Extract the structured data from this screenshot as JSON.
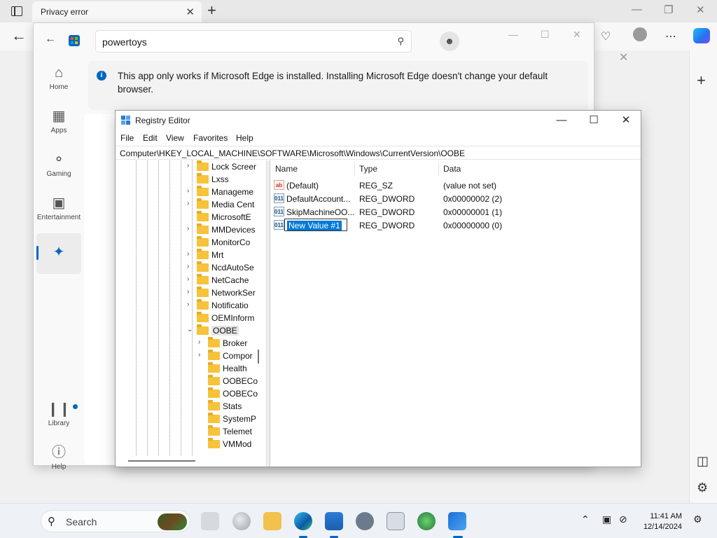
{
  "browser": {
    "tab_title": "Privacy error",
    "tab_close": "✕",
    "new_tab": "+"
  },
  "store": {
    "search_value": "powertoys",
    "banner_text": "This app only works if Microsoft Edge is installed. Installing Microsoft Edge doesn't change your default browser.",
    "nav": [
      {
        "label": "Home",
        "icon": "home-icon"
      },
      {
        "label": "Apps",
        "icon": "apps-icon"
      },
      {
        "label": "Gaming",
        "icon": "gaming-icon"
      },
      {
        "label": "Entertainment",
        "icon": "entertainment-icon"
      },
      {
        "label": "",
        "icon": "sparkle-icon"
      },
      {
        "label": "Library",
        "icon": "library-icon"
      },
      {
        "label": "Help",
        "icon": "help-icon"
      }
    ]
  },
  "regedit": {
    "title": "Registry Editor",
    "menu": [
      "File",
      "Edit",
      "View",
      "Favorites",
      "Help"
    ],
    "address": "Computer\\HKEY_LOCAL_MACHINE\\SOFTWARE\\Microsoft\\Windows\\CurrentVersion\\OOBE",
    "tree": [
      {
        "label": "Lock Screer",
        "expander": "›"
      },
      {
        "label": "Lxss",
        "expander": ""
      },
      {
        "label": "Manageme",
        "expander": "›"
      },
      {
        "label": "Media Cent",
        "expander": "›"
      },
      {
        "label": "MicrosoftE",
        "expander": ""
      },
      {
        "label": "MMDevices",
        "expander": "›"
      },
      {
        "label": "MonitorCo",
        "expander": ""
      },
      {
        "label": "Mrt",
        "expander": "›"
      },
      {
        "label": "NcdAutoSe",
        "expander": "›"
      },
      {
        "label": "NetCache",
        "expander": "›"
      },
      {
        "label": "NetworkSer",
        "expander": "›"
      },
      {
        "label": "Notificatio",
        "expander": "›"
      },
      {
        "label": "OEMInform",
        "expander": ""
      },
      {
        "label": "OOBE",
        "expander": "⌄"
      },
      {
        "label": "Broker",
        "expander": "›"
      },
      {
        "label": "Compor",
        "expander": "›"
      },
      {
        "label": "Health",
        "expander": ""
      },
      {
        "label": "OOBECo",
        "expander": ""
      },
      {
        "label": "OOBECo",
        "expander": ""
      },
      {
        "label": "Stats",
        "expander": ""
      },
      {
        "label": "SystemP",
        "expander": ""
      },
      {
        "label": "Telemet",
        "expander": ""
      },
      {
        "label": "VMMod",
        "expander": ""
      }
    ],
    "columns": {
      "name": "Name",
      "type": "Type",
      "data": "Data"
    },
    "values": [
      {
        "icon": "ab",
        "name": "(Default)",
        "type": "REG_SZ",
        "data": "(value not set)"
      },
      {
        "icon": "011",
        "name": "DefaultAccount...",
        "type": "REG_DWORD",
        "data": "0x00000002 (2)"
      },
      {
        "icon": "011",
        "name": "SkipMachineOO...",
        "type": "REG_DWORD",
        "data": "0x00000001 (1)"
      },
      {
        "icon": "011",
        "name": "New Value #1",
        "type": "REG_DWORD",
        "data": "0x00000000 (0)"
      }
    ]
  },
  "taskbar": {
    "search_placeholder": "Search",
    "time": "11:41 AM",
    "date": "12/14/2024"
  },
  "colors": {
    "accent": "#0067c0",
    "selection": "#0078d7",
    "folder": "#f6c33b"
  }
}
